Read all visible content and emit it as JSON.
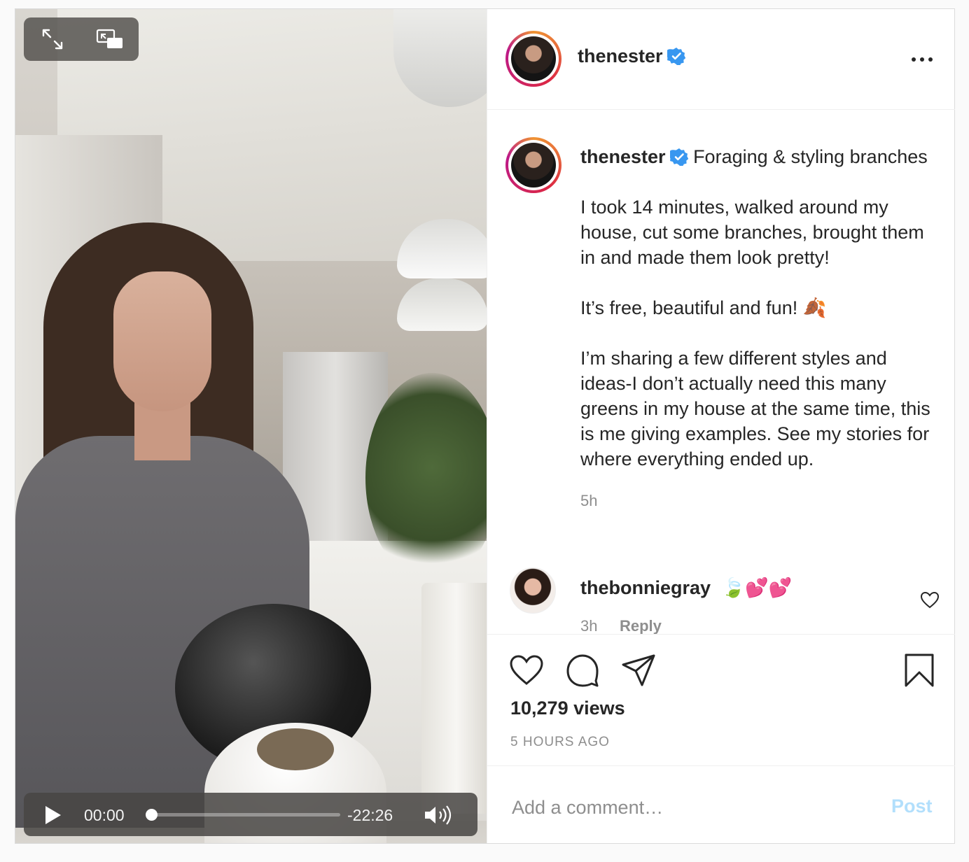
{
  "video": {
    "controls": {
      "fullscreen_icon": "expand-icon",
      "pip_icon": "picture-in-picture-icon"
    },
    "player": {
      "current_time": "00:00",
      "remaining_time": "-22:26",
      "progress": 0
    }
  },
  "header": {
    "username": "thenester",
    "verified": true,
    "more_icon": "more-horizontal-icon"
  },
  "caption": {
    "username": "thenester",
    "title_text": "Foraging & styling branches",
    "paragraphs": [
      "I took 14 minutes, walked around my house, cut some branches, brought them in and made them look pretty!",
      "It’s free, beautiful and fun! 🍂",
      "I’m sharing a few different styles and ideas-I don’t actually need this many greens in my house at the same time, this is me giving examples. See my stories for where everything ended up."
    ],
    "time": "5h"
  },
  "comment": {
    "username": "thebonniegray",
    "text": "🍃💕💕",
    "time": "3h",
    "reply_label": "Reply"
  },
  "actions": {
    "views": "10,279 views",
    "time_ago": "5 HOURS AGO"
  },
  "add_comment": {
    "placeholder": "Add a comment…",
    "post_label": "Post"
  },
  "colors": {
    "link_blue": "#0095f6",
    "post_disabled": "#b2dffc",
    "muted": "#8e8e8e",
    "border": "#dbdbdb"
  }
}
